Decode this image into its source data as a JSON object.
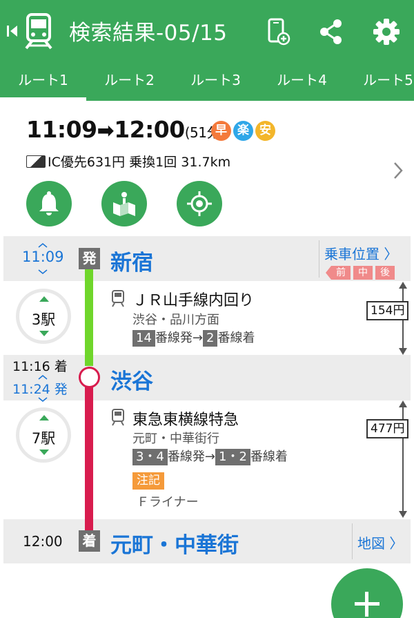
{
  "header": {
    "title": "検索結果-05/15",
    "icons": [
      "skip-back-icon",
      "train-icon",
      "add-to-device-icon",
      "share-icon",
      "settings-icon"
    ]
  },
  "tabs": [
    "ルート1",
    "ルート2",
    "ルート3",
    "ルート4",
    "ルート5"
  ],
  "summary": {
    "dep_time": "11:09",
    "arrow": "➡",
    "arr_time": "12:00",
    "duration": "(51分)",
    "badges": [
      {
        "label": "早",
        "color": "#f47a3c"
      },
      {
        "label": "楽",
        "color": "#2fa7e8"
      },
      {
        "label": "安",
        "color": "#f3b62b"
      }
    ],
    "fare_info": "IC優先631円 乗換1回 31.7km"
  },
  "actions": [
    "alarm-icon",
    "map-pin-icon",
    "location-target-icon"
  ],
  "route": {
    "departure": {
      "time": "11:09",
      "tag": "発",
      "station": "新宿",
      "boarding_link": "乗車位置 〉",
      "cars": [
        "前",
        "中",
        "後"
      ]
    },
    "legs": [
      {
        "stops": "3駅",
        "line": "ＪＲ山手線内回り",
        "direction": "渋谷・品川方面",
        "from_platform": "14",
        "from_suffix": "番線発→",
        "to_platform": "2",
        "to_suffix": "番線着",
        "fare": "154円"
      },
      {
        "stops": "7駅",
        "line": "東急東横線特急",
        "direction": "元町・中華街行",
        "from_platform": "3・4",
        "from_suffix": "番線発→",
        "to_platform": "1・2",
        "to_suffix": "番線着",
        "note_label": "注記",
        "note_text": "Ｆライナー",
        "fare": "477円"
      }
    ],
    "transfer": {
      "arr_time": "11:16 着",
      "dep_time": "11:24 発",
      "station": "渋谷"
    },
    "arrival": {
      "time": "12:00",
      "tag": "着",
      "station": "元町・中華街",
      "map_link": "地図 〉"
    }
  },
  "colors": {
    "brand_green": "#3aa85a",
    "link_blue": "#1a75d6",
    "yamanote_green": "#6fd62b",
    "toyoko_red": "#d81c4e"
  }
}
